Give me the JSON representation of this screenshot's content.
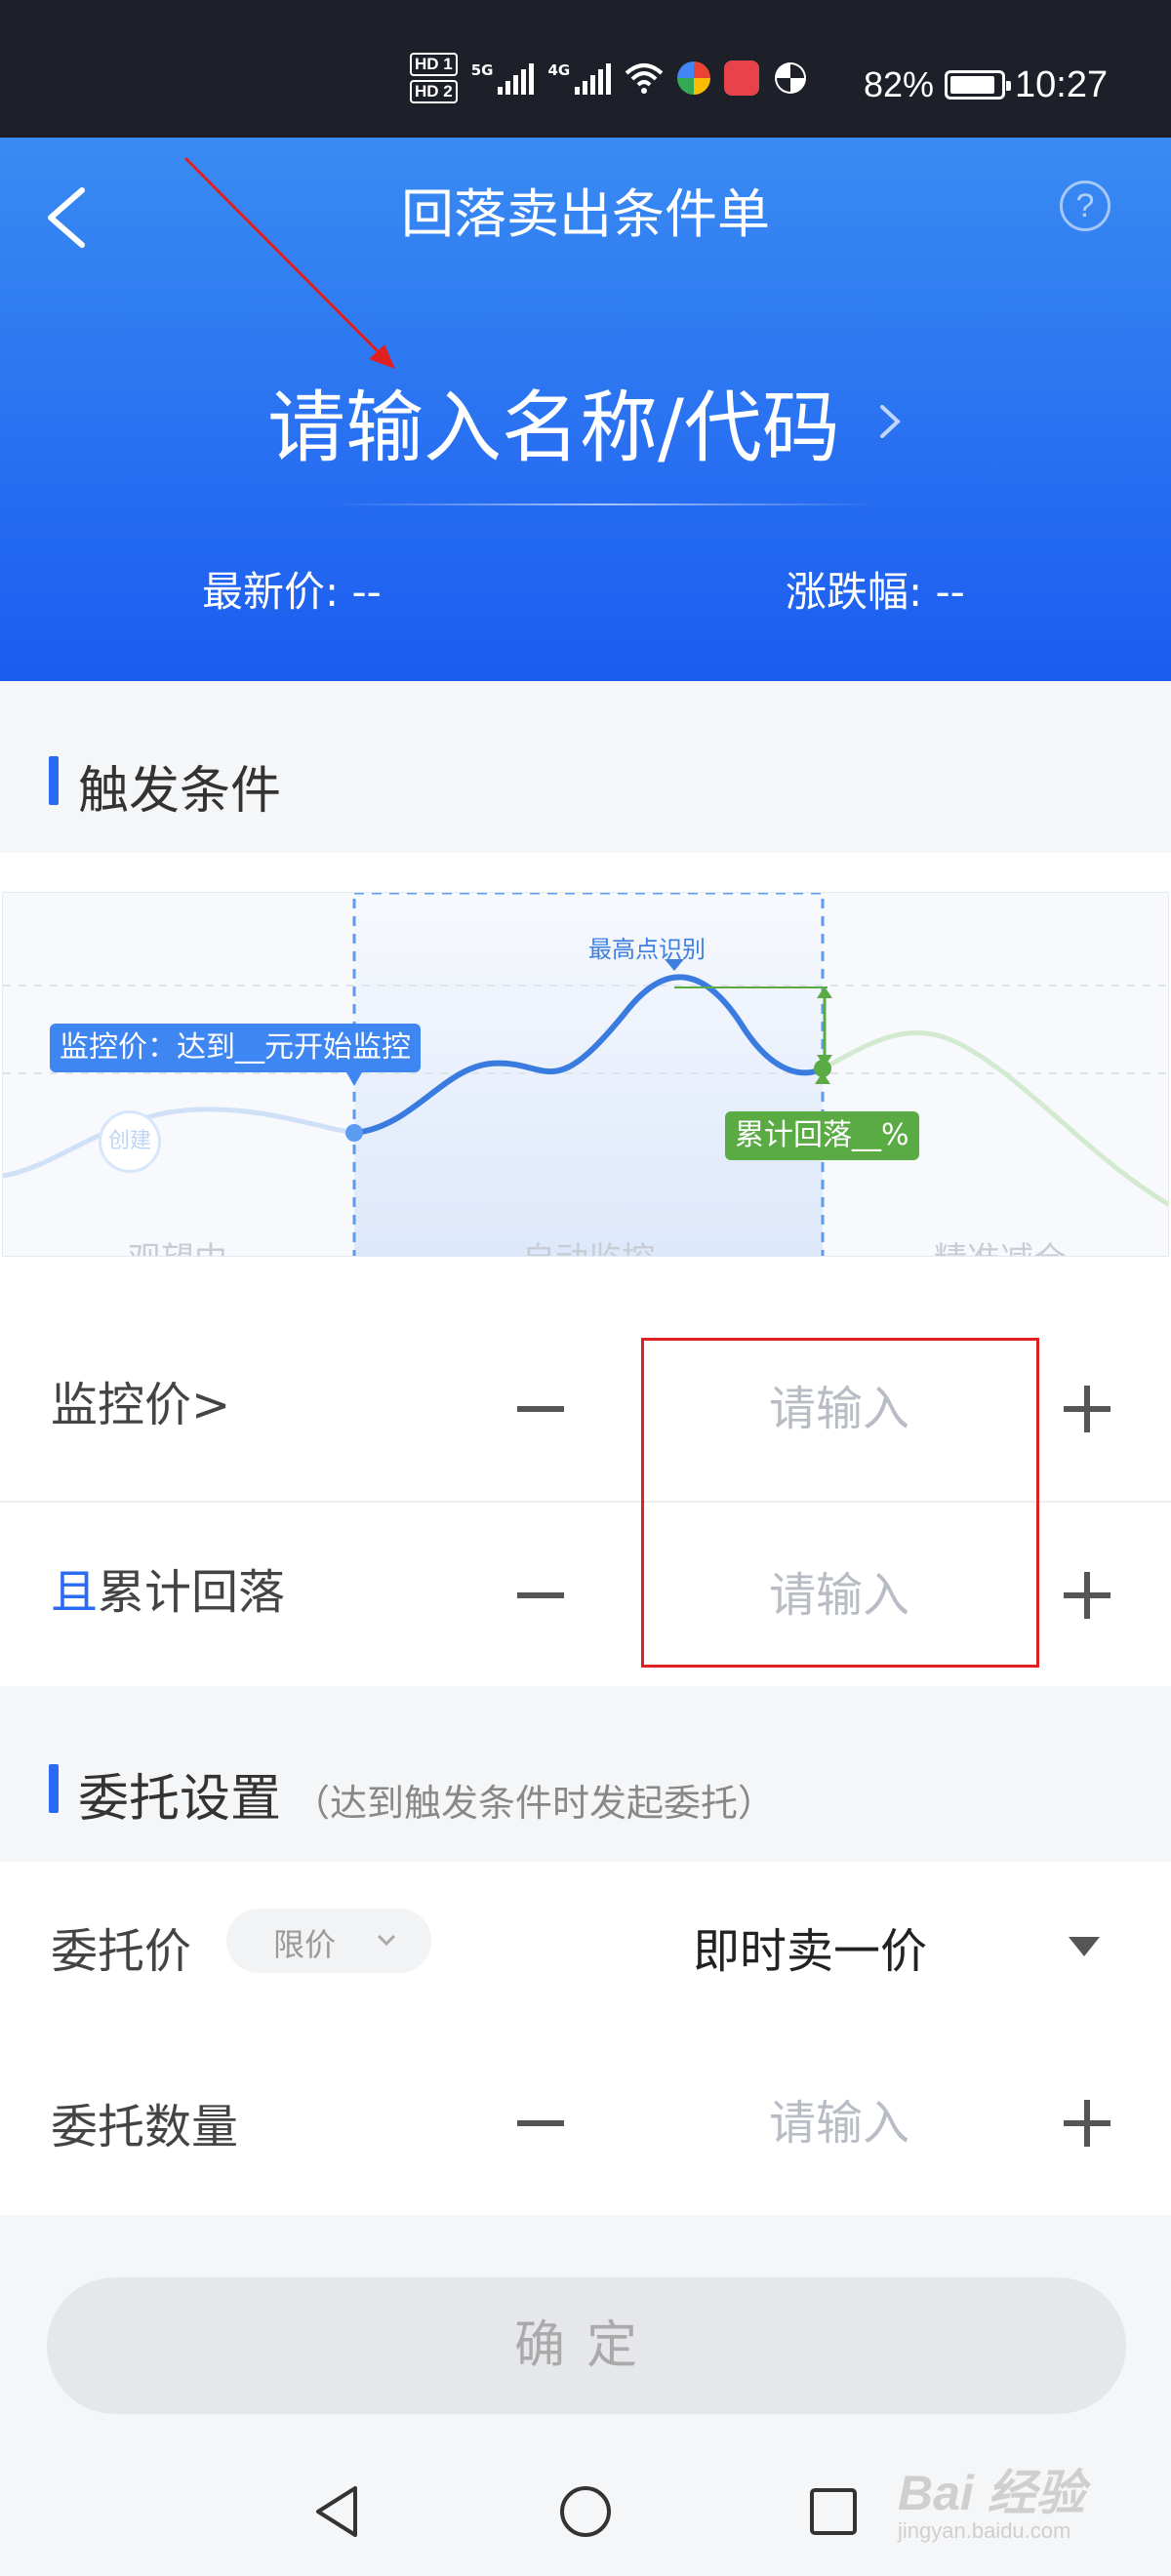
{
  "status_bar": {
    "hd1": "HD 1",
    "hd2": "HD 2",
    "net1": "5G",
    "net2": "4G",
    "battery": "82%",
    "time": "10:27"
  },
  "header": {
    "title": "回落卖出条件单",
    "help": "?",
    "stock_placeholder": "请输入名称/代码",
    "latest_price_label": "最新价: --",
    "change_label": "涨跌幅: --"
  },
  "trigger": {
    "section_title": "触发条件",
    "chart": {
      "create": "创建",
      "monitor_tip": "监控价：达到__元开始监控",
      "peak_tip": "最高点识别",
      "drawdown_tip": "累计回落__%",
      "stages": [
        "观望中",
        "自动监控",
        "精准减仓"
      ]
    },
    "monitor_row": {
      "label": "监控价>",
      "placeholder": "请输入"
    },
    "drawdown_row": {
      "prefix": "且",
      "label": "累计回落",
      "placeholder": "请输入"
    }
  },
  "order": {
    "section_title": "委托设置",
    "section_note": "（达到触发条件时发起委托）",
    "price_label": "委托价",
    "price_type": "限价",
    "price_mode": "即时卖一价",
    "qty_label": "委托数量",
    "qty_placeholder": "请输入"
  },
  "confirm": "确定",
  "watermark": {
    "brand": "Bai 经验",
    "url": "jingyan.baidu.com"
  },
  "colors": {
    "header_top": "#3a8bf2",
    "header_bottom": "#1b5cf0",
    "accent": "#2b6bf3",
    "green": "#5aab44",
    "annotation": "#e02020"
  }
}
